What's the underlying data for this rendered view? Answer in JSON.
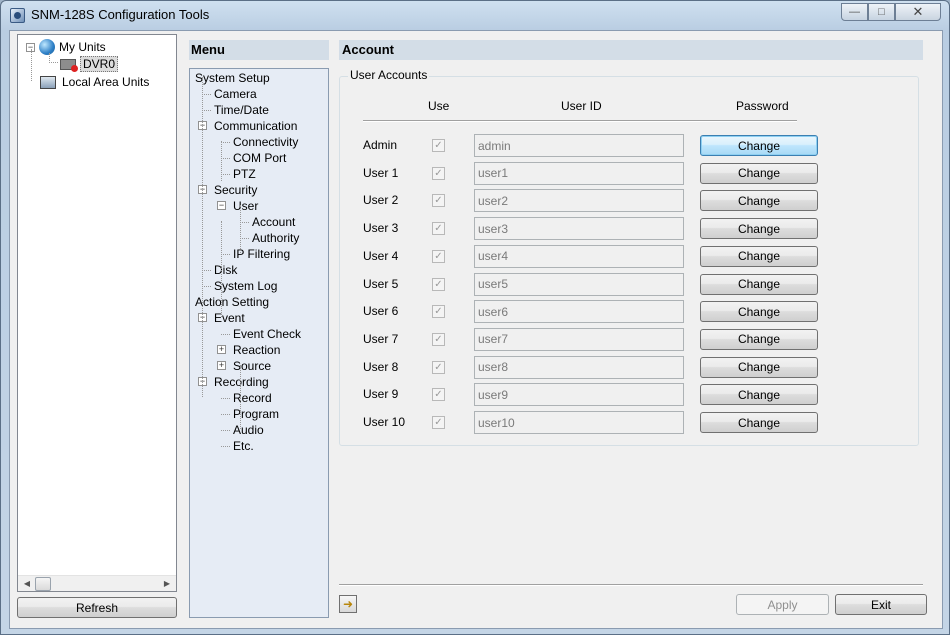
{
  "window": {
    "title": "SNM-128S Configuration Tools"
  },
  "unit_tree": {
    "root": "My Units",
    "device": "DVR0",
    "local": "Local Area Units",
    "refresh_label": "Refresh"
  },
  "menu": {
    "header": "Menu",
    "items": [
      "System Setup",
      "Camera",
      "Time/Date",
      "Communication",
      "Connectivity",
      "COM Port",
      "PTZ",
      "Security",
      "User",
      "Account",
      "Authority",
      "IP Filtering",
      "Disk",
      "System Log",
      "Action Setting",
      "Event",
      "Event Check",
      "Reaction",
      "Source",
      "Recording",
      "Record",
      "Program",
      "Audio",
      "Etc."
    ]
  },
  "account": {
    "header": "Account",
    "group_label": "User Accounts",
    "columns": {
      "use": "Use",
      "user_id": "User ID",
      "password": "Password"
    },
    "change_label": "Change",
    "checkmark": "✓",
    "rows": [
      {
        "label": "Admin",
        "user_id": "admin"
      },
      {
        "label": "User 1",
        "user_id": "user1"
      },
      {
        "label": "User 2",
        "user_id": "user2"
      },
      {
        "label": "User 3",
        "user_id": "user3"
      },
      {
        "label": "User 4",
        "user_id": "user4"
      },
      {
        "label": "User 5",
        "user_id": "user5"
      },
      {
        "label": "User 6",
        "user_id": "user6"
      },
      {
        "label": "User 7",
        "user_id": "user7"
      },
      {
        "label": "User 8",
        "user_id": "user8"
      },
      {
        "label": "User 9",
        "user_id": "user9"
      },
      {
        "label": "User 10",
        "user_id": "user10"
      }
    ]
  },
  "footer": {
    "apply_label": "Apply",
    "exit_label": "Exit"
  },
  "icons": {
    "export": "export-icon",
    "close": "close-icon",
    "minimize": "minimize-icon",
    "maximize": "maximize-icon"
  }
}
